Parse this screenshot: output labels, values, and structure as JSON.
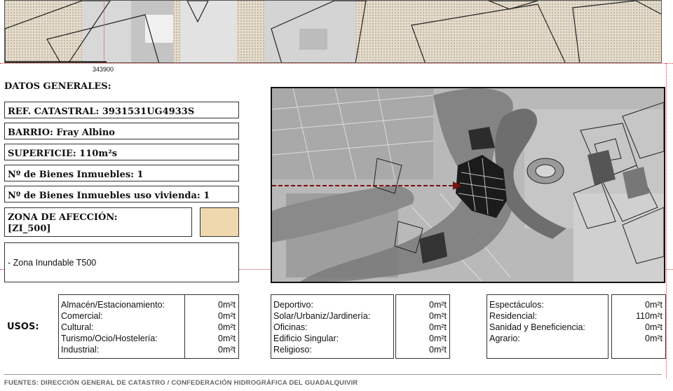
{
  "map_top": {
    "scale_label": "343900"
  },
  "general": {
    "heading": "DATOS GENERALES:",
    "ref_catastral": "REF. CATASTRAL: 3931531UG4933S",
    "barrio": "BARRIO: Fray Albino",
    "superficie": "SUPERFICIE: 110m²s",
    "n_bienes": "Nº de Bienes Inmuebles: 1",
    "n_bienes_vivienda": "Nº de Bienes Inmuebles uso vivienda: 1",
    "zona_label": "ZONA DE AFECCIÓN:",
    "zona_code": "[ZI_500]",
    "zona_desc": "- Zona Inundable T500",
    "zona_color": "#efd8ad"
  },
  "usos": {
    "label": "USOS:",
    "col1": {
      "names": [
        "Almacén/Estacionamiento:",
        "Comercial:",
        "Cultural:",
        "Turismo/Ocio/Hostelería:",
        "Industrial:"
      ],
      "values": [
        "0m²t",
        "0m²t",
        "0m²t",
        "0m²t",
        "0m²t"
      ]
    },
    "col2": {
      "names": [
        "Deportivo:",
        "Solar/Urbaniz/Jardinería:",
        "Oficinas:",
        "Edificio Singular:",
        "Religioso:"
      ],
      "values": [
        "0m²t",
        "0m²t",
        "0m²t",
        "0m²t",
        "0m²t"
      ]
    },
    "col3": {
      "names": [
        "Espectáculos:",
        "Residencial:",
        "Sanidad y Beneficiencia:",
        "Agrario:"
      ],
      "values": [
        "0m²t",
        "110m²t",
        "0m²t",
        "0m²t"
      ]
    }
  },
  "footer": {
    "sources": "FUENTES: DIRECCIÓN GENERAL DE CATASTRO / CONFEDERACIÓN HIDROGRÁFICA DEL GUADALQUIVIR"
  }
}
